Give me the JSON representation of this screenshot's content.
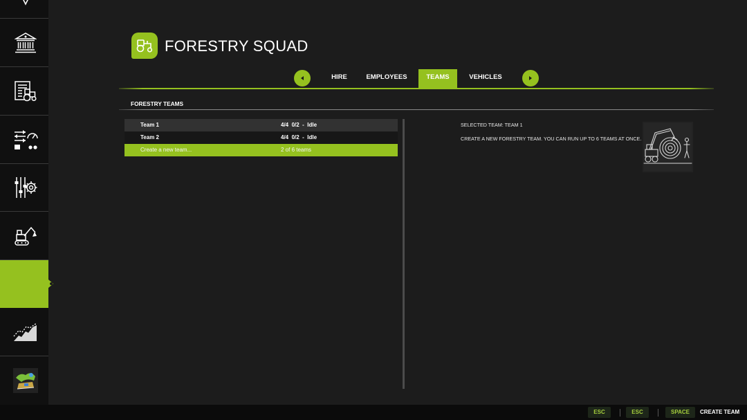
{
  "theme": {
    "accent": "#95c11f",
    "background": "#1c1c1c",
    "sidebar_background": "#101010",
    "footer_background": "#0b0b0b"
  },
  "sidebar": {
    "items": [
      {
        "icon": "chevron-down-icon"
      },
      {
        "icon": "bank-icon"
      },
      {
        "icon": "contracts-icon"
      },
      {
        "icon": "prices-gauge-icon"
      },
      {
        "icon": "settings-sliders-icon"
      },
      {
        "icon": "excavator-icon"
      },
      {
        "selected": true
      },
      {
        "icon": "statistics-chart-icon"
      },
      {
        "icon": "map-thumbnail-icon"
      }
    ]
  },
  "header": {
    "icon": "tractor-icon",
    "title": "FORESTRY SQUAD"
  },
  "tabs": {
    "prev_icon": "arrow-left-icon",
    "next_icon": "arrow-right-icon",
    "items": [
      {
        "label": "HIRE",
        "selected": false
      },
      {
        "label": "EMPLOYEES",
        "selected": false
      },
      {
        "label": "TEAMS",
        "selected": true
      },
      {
        "label": "VEHICLES",
        "selected": false
      }
    ]
  },
  "section": {
    "title": "FORESTRY TEAMS"
  },
  "teams": {
    "rows": [
      {
        "name": "Team 1",
        "status": "4/4  0/2  -  Idle"
      },
      {
        "name": "Team 2",
        "status": "4/4  0/2  -  Idle"
      },
      {
        "name": "Create a new team...",
        "status": "2 of 6 teams",
        "selected": true
      }
    ]
  },
  "details": {
    "selected_team": "SELECTED TEAM: TEAM 1",
    "description": "CREATE A NEW FORESTRY TEAM. YOU CAN RUN UP TO 6 TEAMS AT ONCE.",
    "image_icon": "forestry-harvester-sketch-icon"
  },
  "footer": {
    "actions": [
      {
        "key": "ESC"
      },
      {
        "key": "ESC"
      },
      {
        "key": "SPACE",
        "label": "CREATE TEAM"
      }
    ]
  }
}
